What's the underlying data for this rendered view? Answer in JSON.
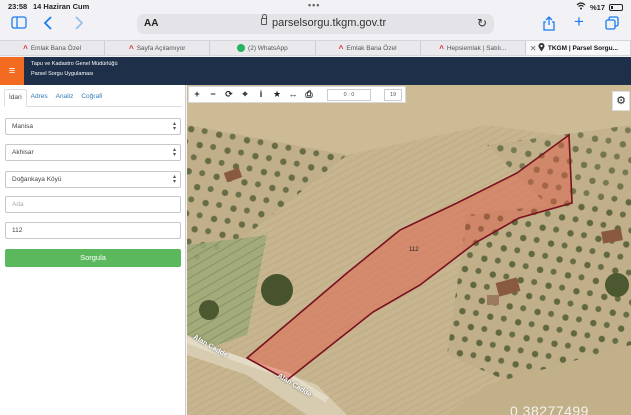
{
  "status": {
    "time": "23:58",
    "date": "14 Haziran Cum",
    "battery": "%17"
  },
  "browser": {
    "aa_label": "AA",
    "url": "parselsorgu.tkgm.gov.tr",
    "tabs": [
      {
        "label": "Emlak Bana Özel",
        "icon": "emlakjet-icon"
      },
      {
        "label": "Sayfa Açılamıyor",
        "icon": "emlakjet-icon"
      },
      {
        "label": "(2) WhatsApp",
        "icon": "whatsapp-icon"
      },
      {
        "label": "Emlak Bana Özel",
        "icon": "emlakjet-icon"
      },
      {
        "label": "Hepsiemlak | Satılı...",
        "icon": "emlakjet-icon"
      },
      {
        "label": "TKGM | Parsel Sorgu...",
        "icon": "location-icon"
      }
    ]
  },
  "header": {
    "line1": "Tapu ve Kadastro Genel Müdürlüğü",
    "line2": "Parsel Sorgu Uygulaması"
  },
  "sidebar": {
    "tabs": [
      "İdari",
      "Adres",
      "Analiz",
      "Coğrafi"
    ],
    "il": "Manisa",
    "ilce": "Akhisar",
    "mahalle": "Doğankaya Köyü",
    "ada_placeholder": "Ada",
    "parsel": "112",
    "submit_label": "Sorgula"
  },
  "map": {
    "coords": "0 : 0",
    "zoom": "19",
    "parcel_label": "112",
    "road_label_1": "Alan Cadde",
    "road_label_2": "Alan Cadde",
    "phone_watermark": "0 38277499",
    "parcel_color": "#e8503f",
    "parcel_border": "#7a1020"
  }
}
